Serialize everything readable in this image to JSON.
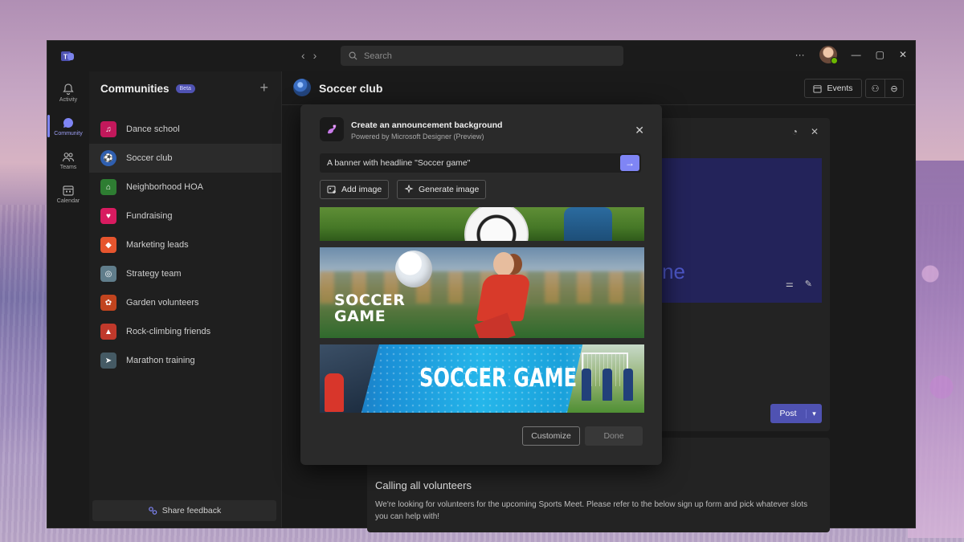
{
  "search": {
    "placeholder": "Search"
  },
  "rail": [
    {
      "label": "Activity",
      "icon": "bell-icon"
    },
    {
      "label": "Community",
      "icon": "chat-icon",
      "active": true
    },
    {
      "label": "Teams",
      "icon": "people-icon"
    },
    {
      "label": "Calendar",
      "icon": "calendar-icon"
    }
  ],
  "sidebar": {
    "title": "Communities",
    "badge": "Beta",
    "items": [
      {
        "label": "Dance school",
        "color": "#c2185b",
        "glyph": "♫"
      },
      {
        "label": "Soccer club",
        "color": "#2f5fb0",
        "glyph": "⚽",
        "active": true
      },
      {
        "label": "Neighborhood HOA",
        "color": "#2e7d32",
        "glyph": "⌂"
      },
      {
        "label": "Fundraising",
        "color": "#d81b60",
        "glyph": "♥"
      },
      {
        "label": "Marketing leads",
        "color": "#e6552e",
        "glyph": "◆"
      },
      {
        "label": "Strategy team",
        "color": "#607d8b",
        "glyph": "◎"
      },
      {
        "label": "Garden volunteers",
        "color": "#c1441e",
        "glyph": "✿"
      },
      {
        "label": "Rock-climbing friends",
        "color": "#c0392b",
        "glyph": "▲"
      },
      {
        "label": "Marathon training",
        "color": "#455a64",
        "glyph": "➤"
      }
    ],
    "share_feedback": "Share feedback"
  },
  "main": {
    "title": "Soccer club",
    "events": "Events",
    "preview_text": "ne",
    "post_label": "Post",
    "post_title": "Calling all volunteers",
    "post_body": "We're looking for volunteers for the upcoming Sports Meet. Please refer to the below sign up form and pick whatever slots you can help with!"
  },
  "modal": {
    "title": "Create an announcement background",
    "subtitle": "Powered by Microsoft Designer (Preview)",
    "prompt": "A banner with headline \"Soccer game\"",
    "add_image": "Add image",
    "generate_image": "Generate image",
    "image2_line1": "SOCCER",
    "image2_line2": "GAME",
    "image3_text": "SOCCER GAME",
    "customize": "Customize",
    "done": "Done"
  }
}
